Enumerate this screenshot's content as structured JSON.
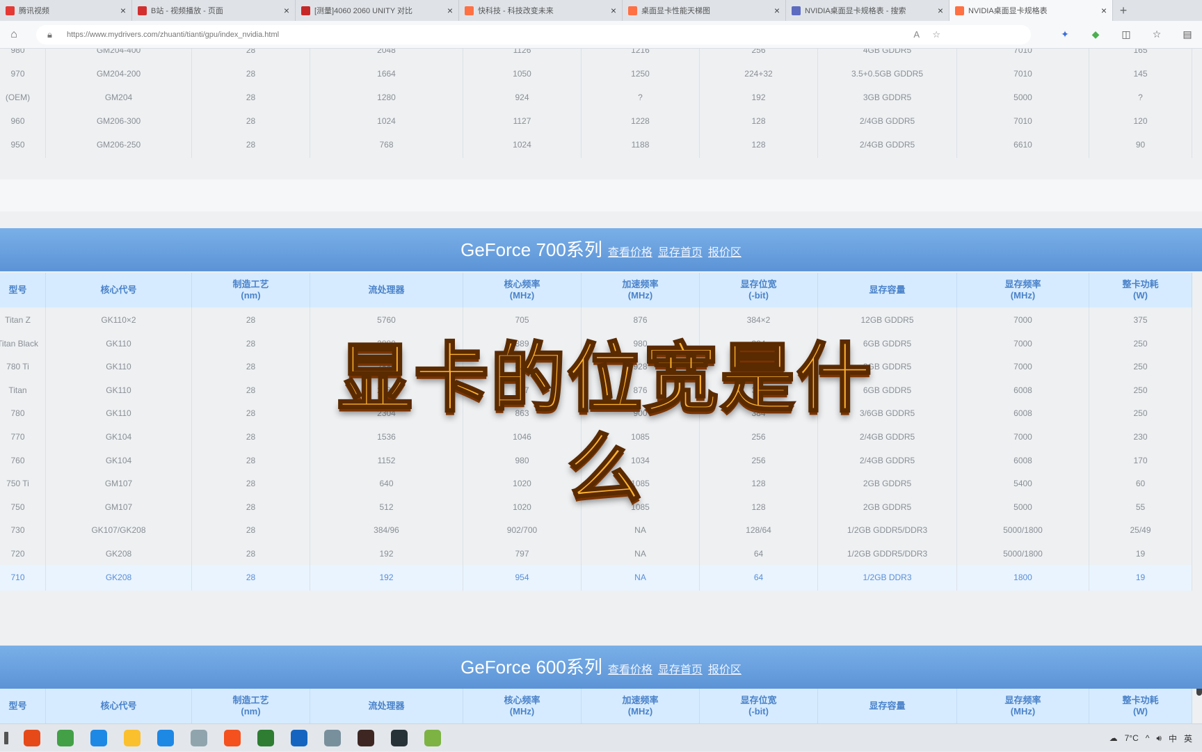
{
  "tabs": [
    {
      "title": "腾讯视频",
      "color": "#e53935",
      "active": false
    },
    {
      "title": "B站 - 视频播放 - 页面",
      "color": "#d32f2f",
      "active": false
    },
    {
      "title": "[测量]4060 2060 UNITY 对比",
      "color": "#c62828",
      "active": false
    },
    {
      "title": "快科技 - 科技改变未来",
      "color": "#ff7043",
      "active": false
    },
    {
      "title": "桌面显卡性能天梯图",
      "color": "#ff7043",
      "active": false
    },
    {
      "title": "NVIDIA桌面显卡规格表 - 搜索",
      "color": "#5c6bc0",
      "active": false
    },
    {
      "title": "NVIDIA桌面显卡规格表",
      "color": "#ff7043",
      "active": true
    }
  ],
  "address": {
    "url": "https://www.mydrivers.com/zhuanti/tianti/gpu/index_nvidia.html"
  },
  "prev_rows": [
    [
      "980",
      "GM204-400",
      "28",
      "2048",
      "1126",
      "1216",
      "256",
      "4GB GDDR5",
      "7010",
      "165"
    ],
    [
      "970",
      "GM204-200",
      "28",
      "1664",
      "1050",
      "1250",
      "224+32",
      "3.5+0.5GB GDDR5",
      "7010",
      "145"
    ],
    [
      "(OEM)",
      "GM204",
      "28",
      "1280",
      "924",
      "?",
      "192",
      "3GB GDDR5",
      "5000",
      "?"
    ],
    [
      "960",
      "GM206-300",
      "28",
      "1024",
      "1127",
      "1228",
      "128",
      "2/4GB GDDR5",
      "7010",
      "120"
    ],
    [
      "950",
      "GM206-250",
      "28",
      "768",
      "1024",
      "1188",
      "128",
      "2/4GB GDDR5",
      "6610",
      "90"
    ]
  ],
  "sections": [
    {
      "title": "GeForce 700系列",
      "links": [
        "查看价格",
        "显存首页",
        "报价区"
      ],
      "headers": [
        [
          "型号"
        ],
        [
          "核心代号"
        ],
        [
          "制造工艺",
          "(nm)"
        ],
        [
          "流处理器"
        ],
        [
          "核心频率",
          "(MHz)"
        ],
        [
          "加速频率",
          "(MHz)"
        ],
        [
          "显存位宽",
          "(-bit)"
        ],
        [
          "显存容量"
        ],
        [
          "显存频率",
          "(MHz)"
        ],
        [
          "整卡功耗",
          "(W)"
        ]
      ],
      "rows": [
        [
          "Titan Z",
          "GK110×2",
          "28",
          "5760",
          "705",
          "876",
          "384×2",
          "12GB GDDR5",
          "7000",
          "375"
        ],
        [
          "Titan Black",
          "GK110",
          "28",
          "2880",
          "889",
          "980",
          "384",
          "6GB GDDR5",
          "7000",
          "250"
        ],
        [
          "780 Ti",
          "GK110",
          "28",
          "2880",
          "875",
          "928",
          "384",
          "3GB GDDR5",
          "7000",
          "250"
        ],
        [
          "Titan",
          "GK110",
          "28",
          "2688",
          "837",
          "876",
          "384",
          "6GB GDDR5",
          "6008",
          "250"
        ],
        [
          "780",
          "GK110",
          "28",
          "2304",
          "863",
          "900",
          "384",
          "3/6GB GDDR5",
          "6008",
          "250"
        ],
        [
          "770",
          "GK104",
          "28",
          "1536",
          "1046",
          "1085",
          "256",
          "2/4GB GDDR5",
          "7000",
          "230"
        ],
        [
          "760",
          "GK104",
          "28",
          "1152",
          "980",
          "1034",
          "256",
          "2/4GB GDDR5",
          "6008",
          "170"
        ],
        [
          "750 Ti",
          "GM107",
          "28",
          "640",
          "1020",
          "1085",
          "128",
          "2GB GDDR5",
          "5400",
          "60"
        ],
        [
          "750",
          "GM107",
          "28",
          "512",
          "1020",
          "1085",
          "128",
          "2GB GDDR5",
          "5000",
          "55"
        ],
        [
          "730",
          "GK107/GK208",
          "28",
          "384/96",
          "902/700",
          "NA",
          "128/64",
          "1/2GB GDDR5/DDR3",
          "5000/1800",
          "25/49"
        ],
        [
          "720",
          "GK208",
          "28",
          "192",
          "797",
          "NA",
          "64",
          "1/2GB GDDR5/DDR3",
          "5000/1800",
          "19"
        ],
        [
          "710",
          "GK208",
          "28",
          "192",
          "954",
          "NA",
          "64",
          "1/2GB DDR3",
          "1800",
          "19"
        ]
      ]
    },
    {
      "title": "GeForce 600系列",
      "links": [
        "查看价格",
        "显存首页",
        "报价区"
      ],
      "headers": [
        [
          "型号"
        ],
        [
          "核心代号"
        ],
        [
          "制造工艺",
          "(nm)"
        ],
        [
          "流处理器"
        ],
        [
          "核心频率",
          "(MHz)"
        ],
        [
          "加速频率",
          "(MHz)"
        ],
        [
          "显存位宽",
          "(-bit)"
        ],
        [
          "显存容量"
        ],
        [
          "显存频率",
          "(MHz)"
        ],
        [
          "整卡功耗",
          "(W)"
        ]
      ]
    }
  ],
  "overlay_caption": "显卡的位宽是什么",
  "taskbar": {
    "apps": [
      {
        "name": "app-icon-1",
        "color": "#e64a19"
      },
      {
        "name": "app-icon-2",
        "color": "#43a047"
      },
      {
        "name": "edge-browser-icon",
        "color": "#1e88e5"
      },
      {
        "name": "media-player-icon",
        "color": "#fbc02d"
      },
      {
        "name": "calendar-icon",
        "color": "#1e88e5"
      },
      {
        "name": "mail-icon",
        "color": "#90a4ae"
      },
      {
        "name": "app-icon-7",
        "color": "#f4511e"
      },
      {
        "name": "app-icon-8",
        "color": "#2e7d32"
      },
      {
        "name": "steam-icon",
        "color": "#1565c0"
      },
      {
        "name": "app-icon-10",
        "color": "#78909c"
      },
      {
        "name": "app-icon-11",
        "color": "#3e2723"
      },
      {
        "name": "app-icon-12",
        "color": "#263238"
      },
      {
        "name": "app-icon-13",
        "color": "#7cb342"
      }
    ],
    "weather": "7°C",
    "ime": "中",
    "lang": "英"
  }
}
